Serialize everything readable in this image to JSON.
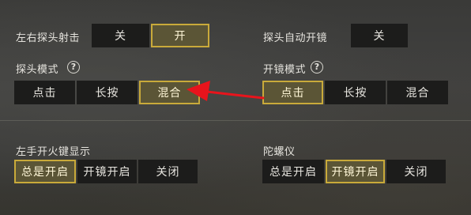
{
  "rows": {
    "peek_fire": {
      "label": "左右探头射击",
      "options": [
        "关",
        "开"
      ],
      "selected": "开"
    },
    "peek_auto_scope": {
      "label": "探头自动开镜",
      "options": [
        "关"
      ],
      "selected": "关"
    },
    "peek_mode": {
      "label": "探头模式",
      "help_icon": "?",
      "options": [
        "点击",
        "长按",
        "混合"
      ],
      "selected": "混合"
    },
    "scope_mode": {
      "label": "开镜模式",
      "help_icon": "?",
      "options": [
        "点击",
        "长按",
        "混合"
      ],
      "selected": "点击"
    },
    "left_fire_display": {
      "label": "左手开火键显示",
      "options": [
        "总是开启",
        "开镜开启",
        "关闭"
      ],
      "selected": "总是开启"
    },
    "gyroscope": {
      "label": "陀螺仪",
      "options": [
        "总是开启",
        "开镜开启",
        "关闭"
      ],
      "selected": "开镜开启"
    }
  },
  "colors": {
    "selected_border": "#c9aa3a",
    "selected_fill": "#5b5536",
    "option_fill": "#1c1c1b",
    "arrow": "#e8141c"
  },
  "annotation": {
    "icon": "red-arrow-icon",
    "points_to": "混合"
  }
}
